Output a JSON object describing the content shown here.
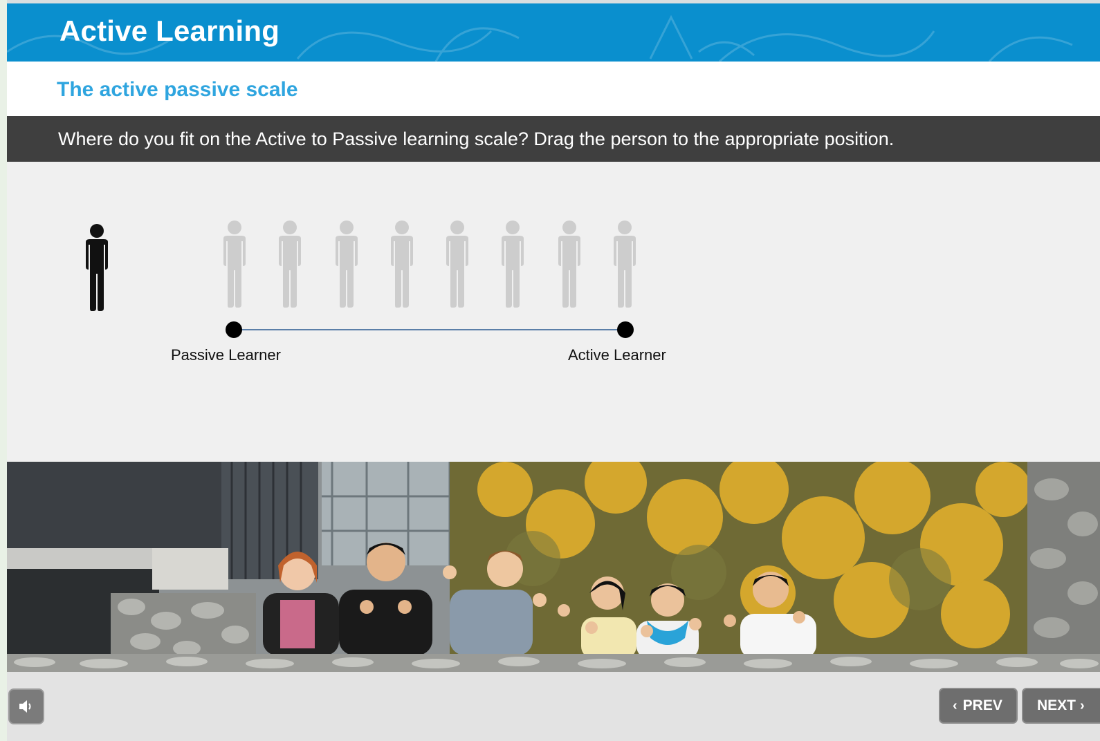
{
  "header": {
    "title": "Active Learning"
  },
  "section": {
    "title": "The active passive scale"
  },
  "instruction": {
    "text": "Where do you fit on the Active to Passive learning scale? Drag the person to the appropriate position."
  },
  "scale": {
    "left_label": "Passive Learner",
    "right_label": "Active Learner",
    "positions": 8,
    "draggable_color": "#111111",
    "slot_color": "#cdcdcd",
    "line_color": "#5b7fa8"
  },
  "footer": {
    "audio_icon": "speaker-icon",
    "prev_label": "PREV",
    "next_label": "NEXT"
  },
  "colors": {
    "header_bg": "#0a8fce",
    "subtitle": "#2fa5df",
    "instruction_bg": "#3f3f3f"
  }
}
